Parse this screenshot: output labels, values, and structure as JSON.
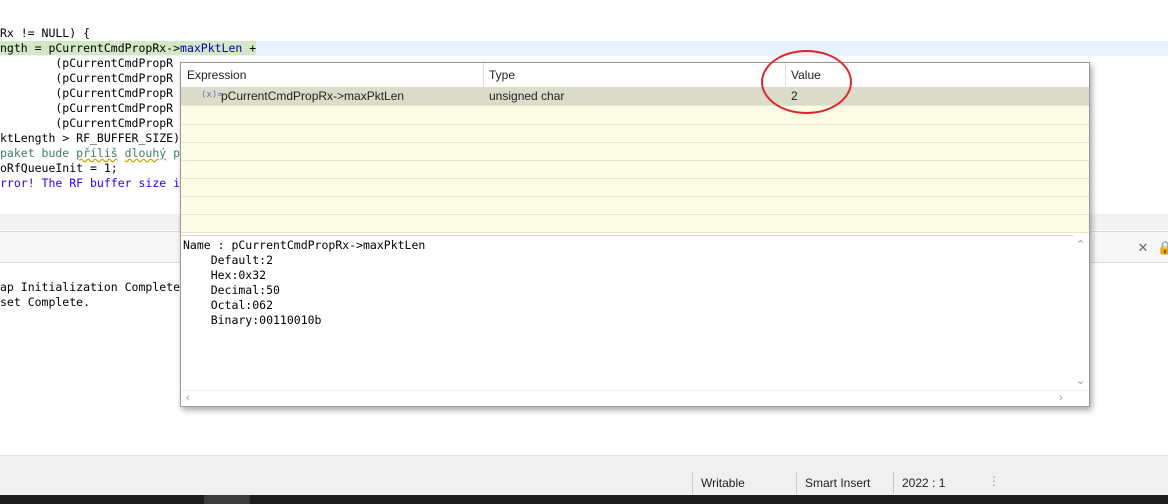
{
  "editor": {
    "lines": [
      "Rx != NULL) {",
      "ngth = pCurrentCmdPropRx->maxPktLen +",
      "        (pCurrentCmdPropR",
      "        (pCurrentCmdPropR",
      "        (pCurrentCmdPropR",
      "        (pCurrentCmdPropR",
      "        (pCurrentCmdPropR",
      "ktLength > RF_BUFFER_SIZE)",
      "paket bude příliš dlouhý p",
      "oRfQueueInit = 1;",
      "rror! The RF buffer size i"
    ],
    "line2_parts": [
      "ngth = pCurrentCmdPropRx->",
      "maxPktLen",
      " +"
    ],
    "line1_comment": "paket bude příliš dlouhý p",
    "line1_comment_squig1": "příliš",
    "line1_comment_squig2": "dlouhý"
  },
  "console": {
    "lines": [
      "ap Initialization Complete",
      "set Complete."
    ],
    "icons": [
      "clear-console-icon",
      "lock-icon"
    ]
  },
  "popup": {
    "columns": [
      "Expression",
      "Type",
      "Value"
    ],
    "row": {
      "icon": "(x)=",
      "expression": "pCurrentCmdPropRx->maxPktLen",
      "type": "unsigned char",
      "value": "2"
    },
    "details": [
      "Name : pCurrentCmdPropRx->maxPktLen",
      "    Default:2",
      "    Hex:0x32",
      "    Decimal:50",
      "    Octal:062",
      "    Binary:00110010b"
    ]
  },
  "status_bar": {
    "writable": "Writable",
    "insert_mode": "Smart Insert",
    "position": "2022 : 1"
  },
  "colors": {
    "annotation": "#e0262a",
    "selected_row": "#dcdccb",
    "table_bg": "#fcfbe4"
  }
}
